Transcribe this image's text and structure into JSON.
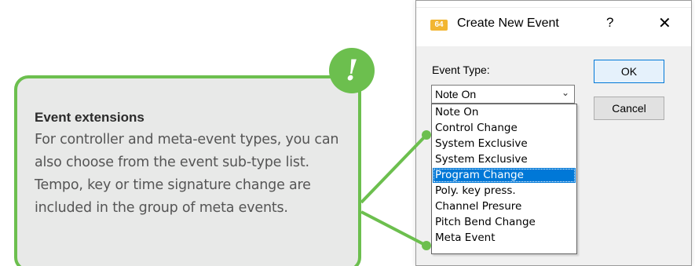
{
  "callout": {
    "title": "Event extensions",
    "body": "For controller and meta-event types, you can also choose from the event sub-type list. Tempo, key or time signature change are included in the group of meta events.",
    "badge_icon": "exclamation-icon",
    "accent_color": "#6cbf4e"
  },
  "dialog": {
    "title": "Create New Event",
    "app_icon_text": "64",
    "help_label": "?",
    "close_label": "✕",
    "event_type_label": "Event Type:",
    "selected_value": "Note On",
    "ok_label": "OK",
    "cancel_label": "Cancel",
    "options": [
      "Note On",
      "Control Change",
      "System Exclusive",
      "System Exclusive",
      "Program Change",
      "Poly. key press.",
      "Channel Presure",
      "Pitch Bend Change",
      "Meta Event"
    ],
    "highlighted_option": "Program Change",
    "highlight_color": "#0078d7"
  }
}
